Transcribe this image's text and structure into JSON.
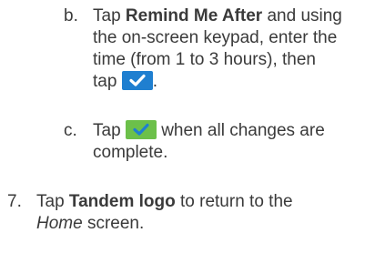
{
  "steps": {
    "b": {
      "marker": "b.",
      "lines": [
        {
          "pre": "Tap ",
          "bold": "Remind Me After",
          "post": " and using"
        },
        {
          "text": "the on-screen keypad, enter the"
        },
        {
          "text": "time (from 1 to 3 hours), then"
        },
        {
          "pre": "tap ",
          "post": "."
        }
      ],
      "icon": {
        "name": "checkmark-icon",
        "color": "#1f7fd0"
      }
    },
    "c": {
      "marker": "c.",
      "lines": [
        {
          "pre": "Tap ",
          "post": " when all changes are"
        },
        {
          "text": "complete."
        }
      ],
      "icon": {
        "name": "checkmark-icon",
        "color": "#6cc04a"
      }
    },
    "seven": {
      "marker": "7.",
      "lines": [
        {
          "pre": "Tap ",
          "bold": "Tandem logo",
          "post": " to return to the"
        },
        {
          "italic": "Home",
          "post": " screen."
        }
      ]
    }
  }
}
